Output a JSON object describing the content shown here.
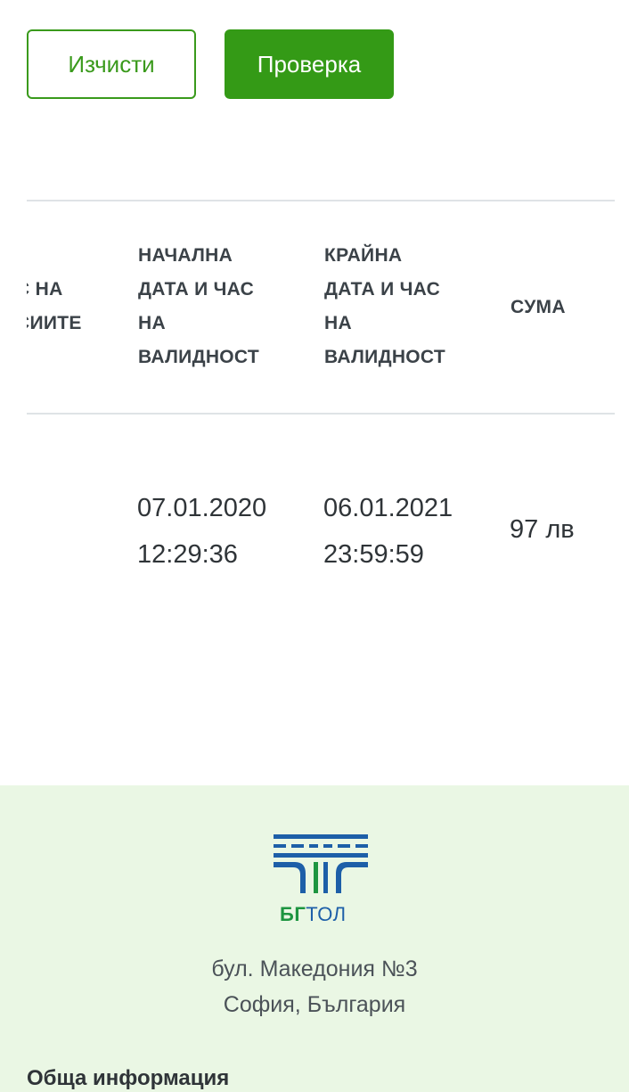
{
  "actions": {
    "clear_label": "Изчисти",
    "check_label": "Проверка"
  },
  "table": {
    "headers": [
      {
        "lines": [
          "С НА",
          "СИИТЕ"
        ]
      },
      {
        "lines": [
          "НАЧАЛНА",
          "ДАТА И ЧАС",
          "НА",
          "ВАЛИДНОСТ"
        ]
      },
      {
        "lines": [
          "КРАЙНА",
          "ДАТА И ЧАС",
          "НА",
          "ВАЛИДНОСТ"
        ]
      },
      {
        "lines": [
          "СУМА"
        ]
      }
    ],
    "rows": [
      {
        "start": {
          "date": "07.01.2020",
          "time": "12:29:36"
        },
        "end": {
          "date": "06.01.2021",
          "time": "23:59:59"
        },
        "amount": "97 лв"
      }
    ]
  },
  "footer": {
    "logo": {
      "icon": "bgtoll-road-logo-icon",
      "text_bg": "БГ",
      "text_tol": "ТОЛ"
    },
    "address_line1": "бул. Македония №3",
    "address_line2": "София, България",
    "section_heading": "Обща информация"
  },
  "colors": {
    "primary_green": "#349a16",
    "footer_bg": "#eaf7e4",
    "logo_blue": "#1d5fa8",
    "logo_green": "#1d9540"
  }
}
